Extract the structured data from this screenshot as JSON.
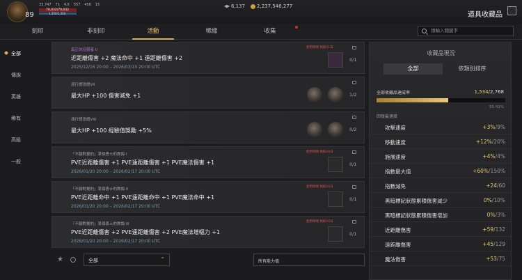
{
  "player": {
    "level": "89",
    "stats": [
      "33,747",
      "71",
      "4.6",
      "557",
      "456",
      "15"
    ],
    "hp": "70,032/70,032",
    "mp": "1,350/1,350"
  },
  "currency": {
    "gems": "6,137",
    "silver": "2,237,546,277"
  },
  "page_title": "道具收藏品",
  "tabs": [
    "刻印",
    "非刻印",
    "活動",
    "稀緣",
    "收集"
  ],
  "active_tab": 2,
  "search": {
    "placeholder": "請輸入關鍵字"
  },
  "left_nav": [
    "全部",
    "傳說",
    "英雄",
    "稀有",
    "高級",
    "一般"
  ],
  "cards": [
    {
      "sub": "真正的征服者 II",
      "main": "近距離傷害 +2 魔法命中 +1 遠距離傷害 +2",
      "date": "2025/12/16 20:00 – 2026/03/10 20:00 UTC",
      "warn": "使用時間 剩餘41日",
      "count": "0/1"
    },
    {
      "sub": "遠行證憑證VII",
      "main": "最大HP +100 傷害減免 +1",
      "date": "",
      "warn": "",
      "count": "1/2"
    },
    {
      "sub": "遠行證憑證VIII",
      "main": "最大HP +100 經驗值獎勵 +5%",
      "date": "",
      "warn": "",
      "count": "0/2"
    },
    {
      "sub": "「不願對覺的」某個勇士的教誨 I",
      "main": "PVE近距離傷害 +1 PVE遠距離傷害 +1 PVE魔法傷害 +1",
      "date": "2026/01/20 20:00 – 2026/02/17 20:00 UTC",
      "warn": "使用時間 剩餘20日",
      "count": "0/1"
    },
    {
      "sub": "「不願對覺的」某個勇士的教誨 II",
      "main": "PVE近距離命中 +1 PVE遠距離命中 +1 PVE魔法命中 +1",
      "date": "2026/01/20 20:00 – 2026/02/17 20:00 UTC",
      "warn": "使用時間 剩餘20日",
      "count": "0/1"
    },
    {
      "sub": "「不願對覺的」某個勇士的教誨 III",
      "main": "PVE近距離傷害 +2 PVE遠距離傷害 +2 PVE魔法增幅力 +1",
      "date": "2026/01/20 20:00 – 2026/02/17 20:00 UTC",
      "warn": "使用時間 剩餘20日",
      "count": "0/1"
    }
  ],
  "filters": {
    "grade": "全部",
    "ability": "所有能力值"
  },
  "panel": {
    "title": "收藏品現況",
    "tabs": [
      "全部",
      "依類別排序"
    ],
    "rate_label": "全部收藏品達成率",
    "rate_current": "1,534",
    "rate_total": "/2,768",
    "rate_pct": "55.42%",
    "rate_fraction": 0.5542,
    "section": "回復最速度",
    "stats": [
      {
        "name": "攻擊速度",
        "cur": "+3%",
        "max": "/9%"
      },
      {
        "name": "移動速度",
        "cur": "+12%",
        "max": "/20%"
      },
      {
        "name": "施展速度",
        "cur": "+4%",
        "max": "/4%"
      },
      {
        "name": "指數最大值",
        "cur": "+60%",
        "max": "/150%"
      },
      {
        "name": "指數減免",
        "cur": "+24",
        "max": "/60"
      },
      {
        "name": "黑暗標記狀態累積傷害減少",
        "cur": "0%",
        "max": "/10%"
      },
      {
        "name": "黑暗標記狀態累積傷害增加",
        "cur": "0%",
        "max": "/3%"
      },
      {
        "name": "近距離傷害",
        "cur": "+59",
        "max": "/132"
      },
      {
        "name": "遠距離傷害",
        "cur": "+45",
        "max": "/129"
      },
      {
        "name": "魔法傷害",
        "cur": "+53",
        "max": "/75"
      }
    ]
  }
}
